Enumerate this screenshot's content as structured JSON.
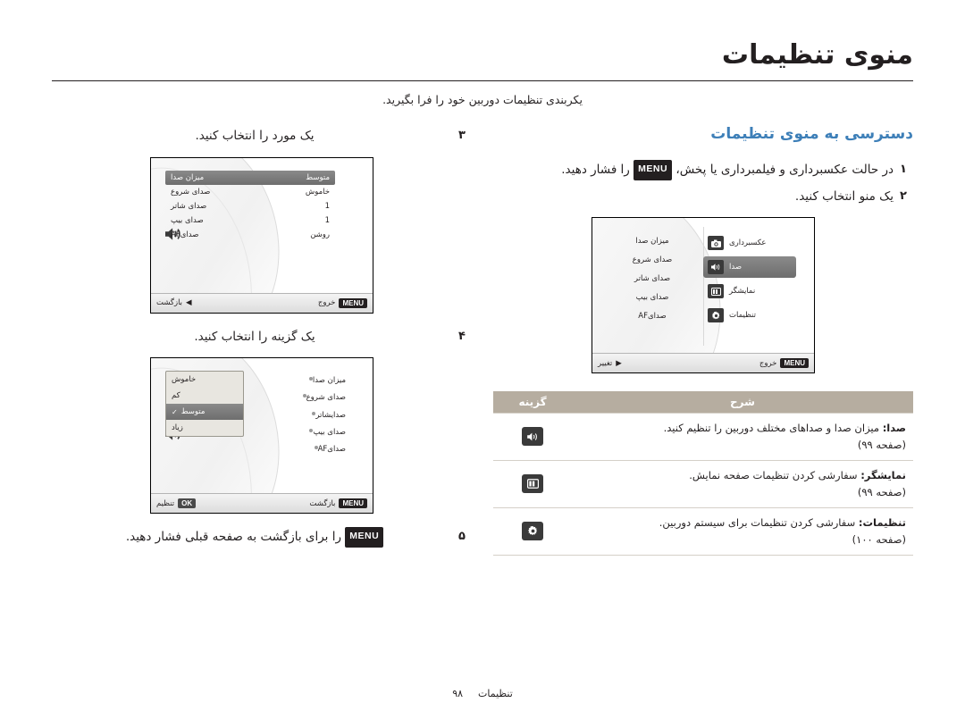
{
  "doc": {
    "title": "منوی تنظیمات",
    "intro": "یکربندی تنظیمات دوربین خود را فرا بگیرید."
  },
  "right_column": {
    "section_title": "دسترسی به منوی تنظیمات",
    "steps": [
      {
        "num": "۱",
        "text_before": "در حالت عکسبرداری و فیلمبرداری یا پخش،",
        "key": "MENU",
        "text_after": "را فشار دهید."
      },
      {
        "num": "۲",
        "text": "یک منو انتخاب کنید."
      }
    ],
    "screen2": {
      "icon_items": [
        {
          "label": "عکسبرداری",
          "icon": "camera-icon",
          "selected": false
        },
        {
          "label": "صدا",
          "icon": "speaker-icon",
          "selected": true
        },
        {
          "label": "نمایشگر",
          "icon": "display-icon",
          "selected": false
        },
        {
          "label": "تنظیمات",
          "icon": "gear-icon",
          "selected": false
        }
      ],
      "right_items": [
        "میزان صدا",
        "صدای شروع",
        "صدای شاتر",
        "صدای بیپ",
        "صدایAF"
      ],
      "bottom_left_label": "خروج",
      "bottom_left_chip": "MENU",
      "bottom_right_label": "تغییر"
    },
    "table": {
      "headers": {
        "icon": "گزینه",
        "desc": "شرح"
      },
      "rows": [
        {
          "icon": "speaker-icon",
          "bold": "صدا:",
          "text": "میزان صدا و صداهای مختلف دوربین را تنظیم کنید.",
          "page_ref": "(صفحه ۹۹)"
        },
        {
          "icon": "display-icon",
          "bold": "نمایشگر:",
          "text": "سفارشی کردن تنظیمات صفحه نمایش.",
          "page_ref": "(صفحه ۹۹)"
        },
        {
          "icon": "gear-icon",
          "bold": "تنظیمات:",
          "text": "سفارشی کردن تنظیمات برای سیستم دوربین.",
          "page_ref": "(صفحه ۱۰۰)"
        }
      ]
    }
  },
  "left_column": {
    "steps": [
      {
        "num": "۳",
        "text": "یک مورد را انتخاب کنید."
      },
      {
        "num": "۴",
        "text": "یک گزینه را انتخاب کنید."
      },
      {
        "num": "۵",
        "text_before": "",
        "key": "MENU",
        "text_after": "را برای بازگشت به صفحه قبلی فشار دهید."
      }
    ],
    "screen3": {
      "rows": [
        {
          "label": "میزان صدا",
          "value": "متوسط",
          "selected": true
        },
        {
          "label": "صدای شروع",
          "value": "خاموش",
          "selected": false
        },
        {
          "label": "صدای شاتر",
          "value": "1",
          "selected": false
        },
        {
          "label": "صدای بیپ",
          "value": "1",
          "selected": false
        },
        {
          "label": "صدایAF",
          "value": "روشن",
          "selected": false
        }
      ],
      "speaker_icon": "speaker-icon",
      "bottom_left_chip": "MENU",
      "bottom_left_label": "خروج",
      "bottom_right_label": "بازگشت"
    },
    "screen4": {
      "list": [
        "میزان صدا",
        "صدای شروع",
        "صدایشاتر",
        "صدای بیپ",
        "صدایAF"
      ],
      "options": [
        {
          "label": "خاموش",
          "selected": false,
          "checked": false
        },
        {
          "label": "کم",
          "selected": false,
          "checked": false
        },
        {
          "label": "متوسط",
          "selected": true,
          "checked": true
        },
        {
          "label": "زیاد",
          "selected": false,
          "checked": false
        }
      ],
      "speaker_icon": "speaker-icon",
      "bottom_left_chip": "MENU",
      "bottom_left_label": "بازگشت",
      "bottom_right_chip": "OK",
      "bottom_right_label": "تنظیم"
    }
  },
  "footer": {
    "label": "تنظیمات",
    "page": "۹۸"
  },
  "colors": {
    "accent_blue": "#3d7fb8",
    "table_header": "#b6ada0",
    "text": "#231f20"
  }
}
